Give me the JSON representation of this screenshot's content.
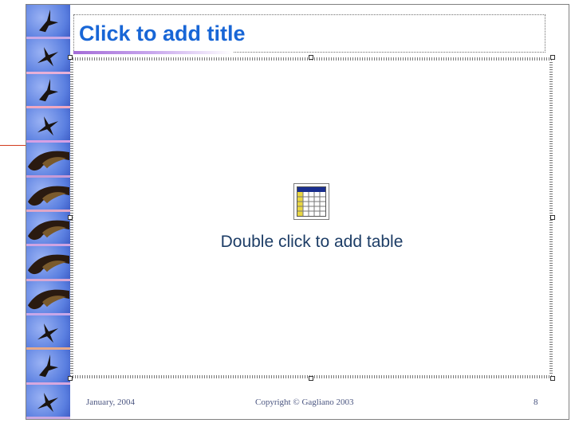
{
  "slide": {
    "title_placeholder": "Click to add title",
    "content_placeholder": "Double click to add table",
    "footer": {
      "date": "January, 2004",
      "copyright": "Copyright © Gagliano 2003",
      "page_number": "8"
    }
  },
  "icons": {
    "table": "table-icon",
    "strip_images": [
      "eagle-icon",
      "eagle-icon",
      "eagle-icon",
      "eagle-icon",
      "eagle-icon",
      "eagle-icon",
      "eagle-icon",
      "eagle-icon",
      "eagle-icon",
      "eagle-icon",
      "eagle-icon",
      "eagle-icon"
    ]
  },
  "colors": {
    "title": "#1866d6",
    "placeholder_text": "#1d3d66",
    "footer_text": "#4a5580",
    "accent_marker": "#d23b1e",
    "strip_sky": "#5a7fe0"
  }
}
